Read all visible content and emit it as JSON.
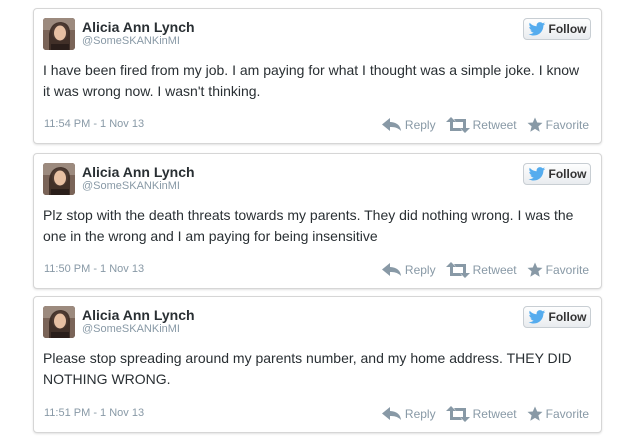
{
  "tweets": [
    {
      "name": "Alicia Ann Lynch",
      "handle": "@SomeSKANKinMI",
      "follow_label": "Follow",
      "text": "I have been fired from my job. I am paying for what I thought was a simple joke. I know it was wrong now. I wasn't thinking.",
      "time": "11:54 PM - 1 Nov 13",
      "reply_label": "Reply",
      "retweet_label": "Retweet",
      "favorite_label": "Favorite"
    },
    {
      "name": "Alicia Ann Lynch",
      "handle": "@SomeSKANKinMI",
      "follow_label": "Follow",
      "text": "Plz stop with the death threats towards my parents. They did nothing wrong. I was the one in the wrong and I am paying for being insensitive",
      "time": "11:50 PM - 1 Nov 13",
      "reply_label": "Reply",
      "retweet_label": "Retweet",
      "favorite_label": "Favorite"
    },
    {
      "name": "Alicia Ann Lynch",
      "handle": "@SomeSKANKinMI",
      "follow_label": "Follow",
      "text": "Please stop spreading around my parents number, and my home address. THEY DID NOTHING WRONG.",
      "time": "11:51 PM - 1 Nov 13",
      "reply_label": "Reply",
      "retweet_label": "Retweet",
      "favorite_label": "Favorite"
    }
  ],
  "colors": {
    "twitter_blue": "#55acee",
    "action_gray": "#8899a6",
    "text": "#292f33"
  }
}
